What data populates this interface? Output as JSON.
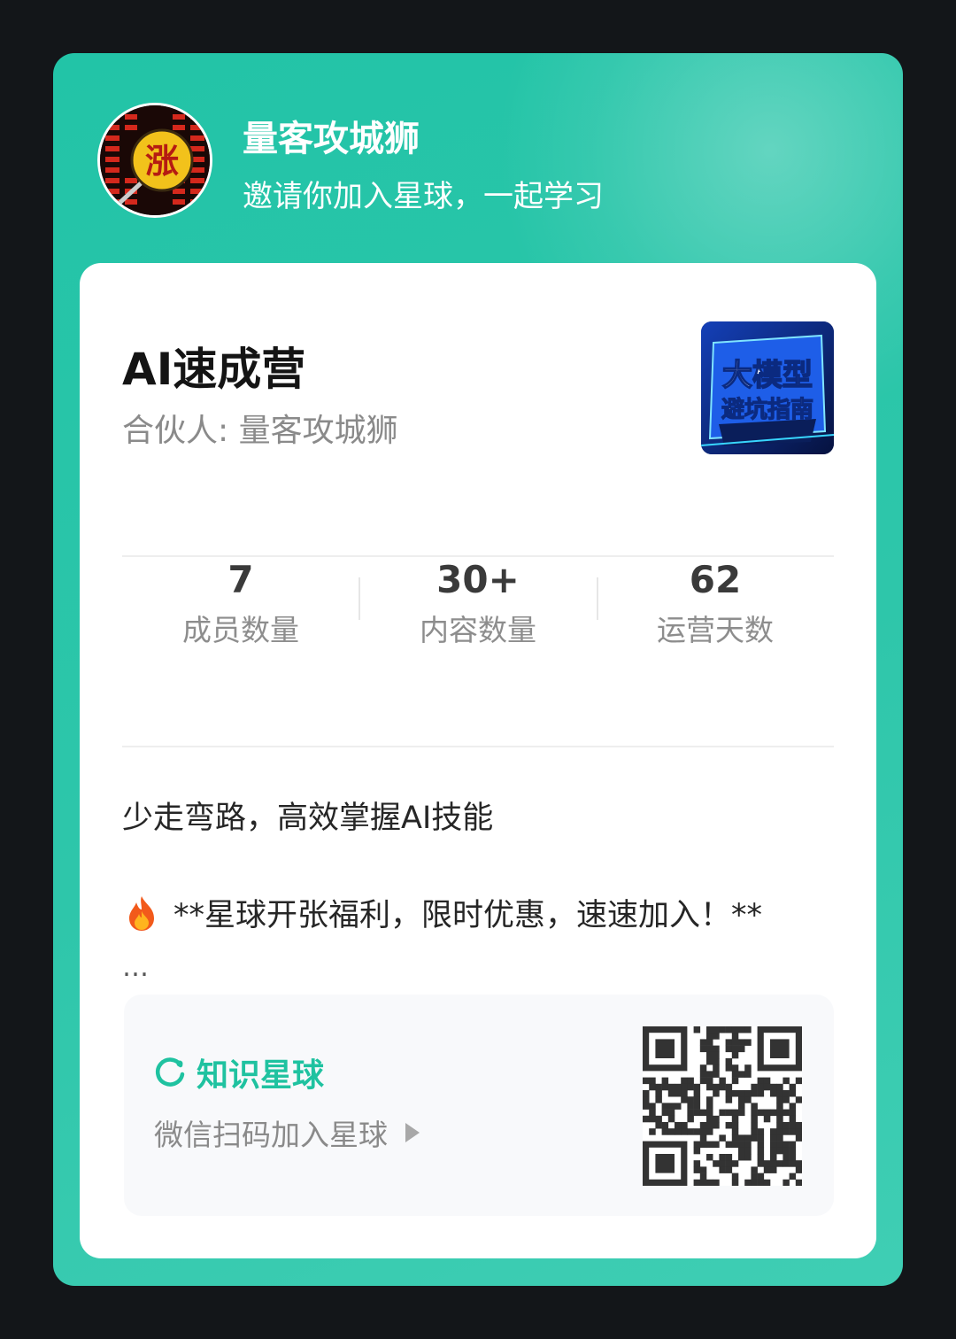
{
  "header": {
    "owner_name": "量客攻城狮",
    "invite_text": "邀请你加入星球，一起学习",
    "avatar_badge_char": "涨"
  },
  "group": {
    "title": "AI速成营",
    "partner": "合伙人:  量客攻城狮",
    "cover_line1": "大模型",
    "cover_line2": "避坑指南"
  },
  "stats": [
    {
      "value": "7",
      "label": "成员数量"
    },
    {
      "value": "30+",
      "label": "内容数量"
    },
    {
      "value": "62",
      "label": "运营天数"
    }
  ],
  "description": {
    "line1": "少走弯路，高效掌握AI技能",
    "line2": "**星球开张福利，限时优惠，速速加入！**",
    "ellipsis": "…"
  },
  "footer": {
    "brand": "知识星球",
    "scan_text": "微信扫码加入星球"
  },
  "colors": {
    "accent": "#1fc2a0",
    "card_bg": "#2ec6aa",
    "page_bg": "#131619"
  }
}
